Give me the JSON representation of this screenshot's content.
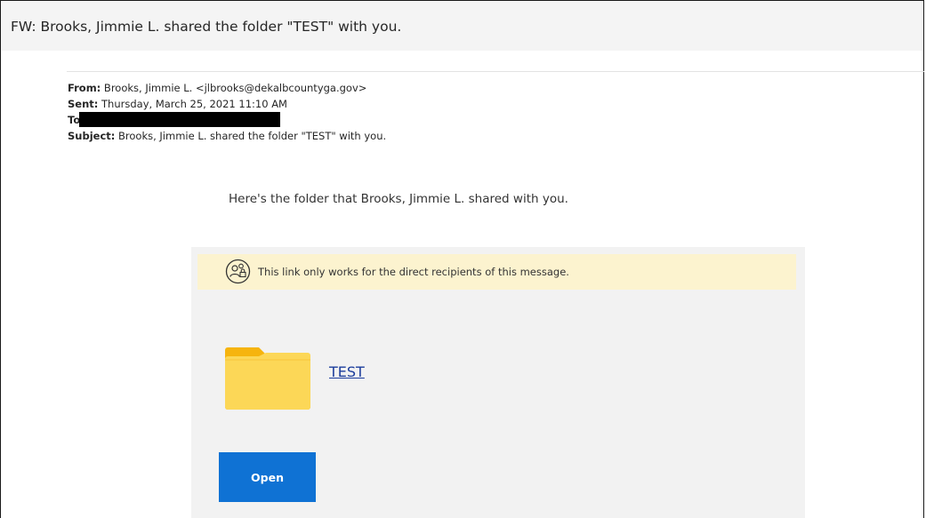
{
  "email": {
    "subject_line": "FW: Brooks, Jimmie L. shared the folder \"TEST\" with you.",
    "from_label": "From:",
    "from_value": " Brooks, Jimmie L. <jlbrooks@dekalbcountyga.gov>",
    "sent_label": "Sent:",
    "sent_value": " Thursday, March 25, 2021 11:10 AM",
    "to_label": "To",
    "subject_label": "Subject:",
    "subject_value": " Brooks, Jimmie L. shared the folder \"TEST\" with you."
  },
  "share": {
    "intro_text": "Here's the folder that Brooks, Jimmie L. shared with you.",
    "notice_text": "This link only works for the direct recipients of this message.",
    "folder_name": "TEST",
    "open_button": "Open"
  },
  "colors": {
    "accent": "#0f72d4",
    "notice_bg": "#fcf3cf",
    "card_bg": "#f2f2f2",
    "link": "#1c3d9c"
  },
  "icons": {
    "notice": "people-lock-icon",
    "folder": "folder-icon"
  }
}
